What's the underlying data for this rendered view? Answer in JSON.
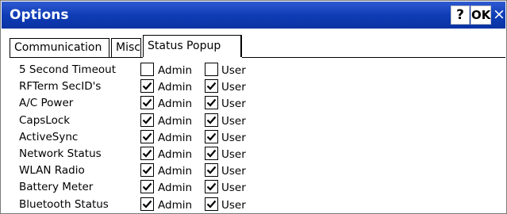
{
  "window": {
    "title": "Options",
    "help_label": "?",
    "ok_label": "OK",
    "close_label": "×"
  },
  "tabs": [
    {
      "label": "Communication",
      "active": false
    },
    {
      "label": "Misc",
      "active": false
    },
    {
      "label": "Status Popup",
      "active": true
    }
  ],
  "columns": {
    "admin": "Admin",
    "user": "User"
  },
  "settings": [
    {
      "label": "5 Second Timeout",
      "admin": false,
      "user": false
    },
    {
      "label": "RFTerm SecID's",
      "admin": true,
      "user": true
    },
    {
      "label": "A/C Power",
      "admin": true,
      "user": true
    },
    {
      "label": "CapsLock",
      "admin": true,
      "user": true
    },
    {
      "label": "ActiveSync",
      "admin": true,
      "user": true
    },
    {
      "label": "Network Status",
      "admin": true,
      "user": true
    },
    {
      "label": "WLAN Radio",
      "admin": true,
      "user": true
    },
    {
      "label": "Battery Meter",
      "admin": true,
      "user": true
    },
    {
      "label": "Bluetooth Status",
      "admin": true,
      "user": true
    }
  ]
}
